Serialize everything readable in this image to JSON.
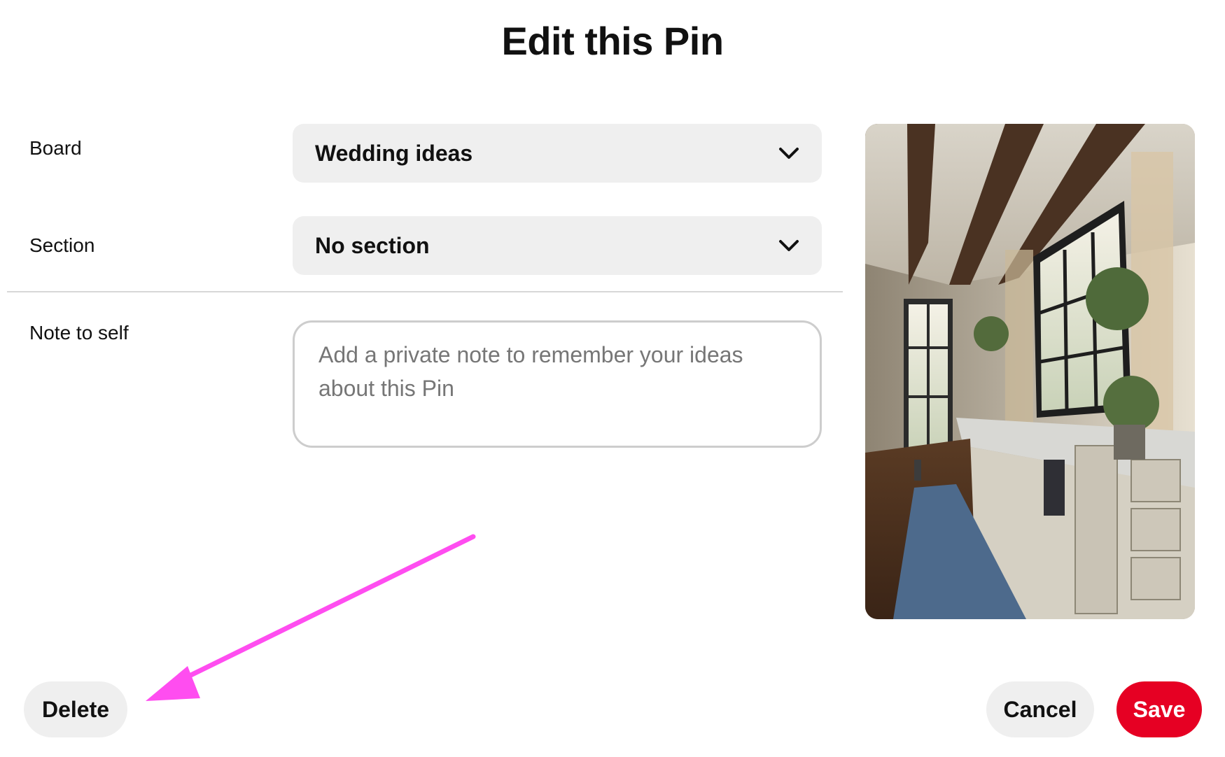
{
  "dialog": {
    "title": "Edit this Pin"
  },
  "fields": {
    "board": {
      "label": "Board",
      "value": "Wedding ideas"
    },
    "section": {
      "label": "Section",
      "value": "No section"
    },
    "note": {
      "label": "Note to self",
      "placeholder": "Add a private note to remember your ideas about this Pin",
      "value": ""
    }
  },
  "actions": {
    "delete_label": "Delete",
    "cancel_label": "Cancel",
    "save_label": "Save"
  },
  "icons": {
    "board_dropdown": "chevron-down-icon",
    "section_dropdown": "chevron-down-icon"
  },
  "colors": {
    "save_button": "#e60023",
    "secondary_button": "#efefef",
    "annotation_arrow": "#ff4df0"
  }
}
